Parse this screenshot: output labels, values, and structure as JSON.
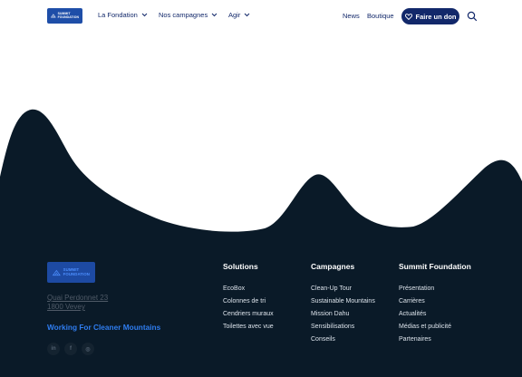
{
  "header": {
    "logo": {
      "line1": "SUMMIT",
      "line2": "FOUNDATION"
    },
    "nav": [
      "La Fondation",
      "Nos campagnes",
      "Agir"
    ],
    "links": [
      "News",
      "Boutique"
    ],
    "donate_label": "Faire un don",
    "icons": {
      "chevron": "chevron-down-icon",
      "heart": "heart-icon",
      "search": "search-icon"
    }
  },
  "footer": {
    "logo": {
      "line1": "SUMMIT",
      "line2": "FOUNDATION"
    },
    "address": [
      "Quai Perdonnet 23",
      "1800 Vevey"
    ],
    "tagline": "Working For Cleaner Mountains",
    "socials": [
      {
        "name": "linkedin-icon",
        "glyph": "in"
      },
      {
        "name": "facebook-icon",
        "glyph": "f"
      },
      {
        "name": "instagram-icon",
        "glyph": "◎"
      }
    ],
    "columns": [
      {
        "title": "Solutions",
        "items": [
          "EcoBox",
          "Colonnes de tri",
          "Cendriers muraux",
          "Toilettes avec vue"
        ]
      },
      {
        "title": "Campagnes",
        "items": [
          "Clean-Up Tour",
          "Sustainable Mountains",
          "Mission Dahu",
          "Sensibilisations",
          "Conseils"
        ]
      },
      {
        "title": "Summit Foundation",
        "items": [
          "Présentation",
          "Carrières",
          "Actualités",
          "Médias et publicité",
          "Partenaires"
        ]
      }
    ]
  },
  "colors": {
    "navy": "#12286a",
    "dark": "#0a1a28",
    "accent_blue": "#2f7df0",
    "logo_blue": "#1e4ea8"
  }
}
